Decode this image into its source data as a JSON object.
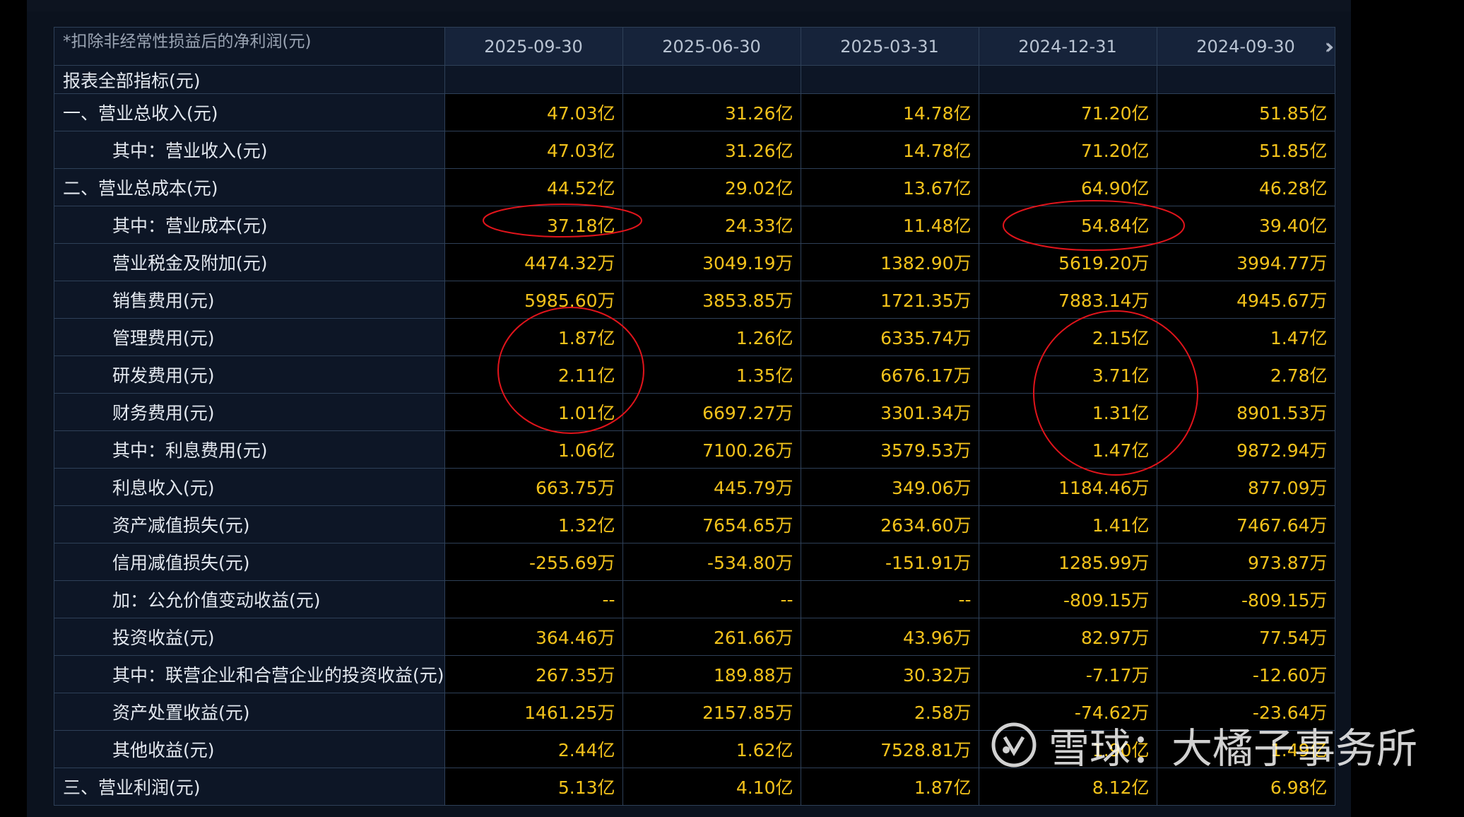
{
  "table": {
    "top_label": "*扣除非经常性损益后的净利润(元)",
    "header_label": "报表全部指标(元)",
    "dates": [
      "2025-09-30",
      "2025-06-30",
      "2025-03-31",
      "2024-12-31",
      "2024-09-30"
    ],
    "next_icon": "double-chevron-right-icon",
    "rows": [
      {
        "label": "一、营业总收入(元)",
        "indent": false,
        "values": [
          "47.03亿",
          "31.26亿",
          "14.78亿",
          "71.20亿",
          "51.85亿"
        ]
      },
      {
        "label": "其中：营业收入(元)",
        "indent": true,
        "values": [
          "47.03亿",
          "31.26亿",
          "14.78亿",
          "71.20亿",
          "51.85亿"
        ]
      },
      {
        "label": "二、营业总成本(元)",
        "indent": false,
        "values": [
          "44.52亿",
          "29.02亿",
          "13.67亿",
          "64.90亿",
          "46.28亿"
        ]
      },
      {
        "label": "其中：营业成本(元)",
        "indent": true,
        "values": [
          "37.18亿",
          "24.33亿",
          "11.48亿",
          "54.84亿",
          "39.40亿"
        ]
      },
      {
        "label": "营业税金及附加(元)",
        "indent": true,
        "values": [
          "4474.32万",
          "3049.19万",
          "1382.90万",
          "5619.20万",
          "3994.77万"
        ]
      },
      {
        "label": "销售费用(元)",
        "indent": true,
        "values": [
          "5985.60万",
          "3853.85万",
          "1721.35万",
          "7883.14万",
          "4945.67万"
        ]
      },
      {
        "label": "管理费用(元)",
        "indent": true,
        "values": [
          "1.87亿",
          "1.26亿",
          "6335.74万",
          "2.15亿",
          "1.47亿"
        ]
      },
      {
        "label": "研发费用(元)",
        "indent": true,
        "values": [
          "2.11亿",
          "1.35亿",
          "6676.17万",
          "3.71亿",
          "2.78亿"
        ]
      },
      {
        "label": "财务费用(元)",
        "indent": true,
        "values": [
          "1.01亿",
          "6697.27万",
          "3301.34万",
          "1.31亿",
          "8901.53万"
        ]
      },
      {
        "label": "其中：利息费用(元)",
        "indent": true,
        "values": [
          "1.06亿",
          "7100.26万",
          "3579.53万",
          "1.47亿",
          "9872.94万"
        ]
      },
      {
        "label": "利息收入(元)",
        "indent": true,
        "values": [
          "663.75万",
          "445.79万",
          "349.06万",
          "1184.46万",
          "877.09万"
        ]
      },
      {
        "label": "资产减值损失(元)",
        "indent": true,
        "values": [
          "1.32亿",
          "7654.65万",
          "2634.60万",
          "1.41亿",
          "7467.64万"
        ]
      },
      {
        "label": "信用减值损失(元)",
        "indent": true,
        "values": [
          "-255.69万",
          "-534.80万",
          "-151.91万",
          "1285.99万",
          "973.87万"
        ]
      },
      {
        "label": "加：公允价值变动收益(元)",
        "indent": true,
        "values": [
          "--",
          "--",
          "--",
          "-809.15万",
          "-809.15万"
        ]
      },
      {
        "label": "投资收益(元)",
        "indent": true,
        "values": [
          "364.46万",
          "261.66万",
          "43.96万",
          "82.97万",
          "77.54万"
        ]
      },
      {
        "label": "其中：联营企业和合营企业的投资收益(元)",
        "indent": true,
        "values": [
          "267.35万",
          "189.88万",
          "30.32万",
          "-7.17万",
          "-12.60万"
        ]
      },
      {
        "label": "资产处置收益(元)",
        "indent": true,
        "values": [
          "1461.25万",
          "2157.85万",
          "2.58万",
          "-74.62万",
          "-23.64万"
        ]
      },
      {
        "label": "其他收益(元)",
        "indent": true,
        "values": [
          "2.44亿",
          "1.62亿",
          "7528.81万",
          "1.90亿",
          "1.49亿"
        ]
      },
      {
        "label": "三、营业利润(元)",
        "indent": false,
        "values": [
          "5.13亿",
          "4.10亿",
          "1.87亿",
          "8.12亿",
          "6.98亿"
        ]
      }
    ]
  },
  "annotation_color": "#e0141b",
  "value_color": "#f3c21b",
  "watermark": {
    "logo_icon": "xueqiu-logo-icon",
    "text": "雪球：大橘子事务所"
  }
}
